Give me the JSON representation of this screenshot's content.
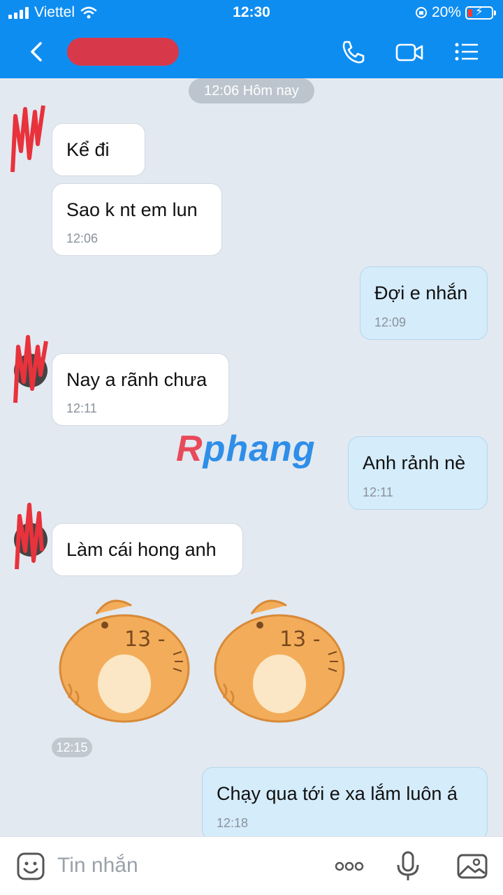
{
  "status": {
    "carrier": "Viettel",
    "time": "12:30",
    "battery": "20%"
  },
  "header": {
    "icons": [
      "back-icon",
      "phone-icon",
      "video-icon",
      "menu-icon"
    ]
  },
  "chat": {
    "date_label": "12:06 Hôm nay",
    "messages": [
      {
        "from": "them",
        "text": "Kể đi",
        "time": ""
      },
      {
        "from": "them",
        "text": "Sao k nt em lun",
        "time": "12:06"
      },
      {
        "from": "me",
        "text": "Đợi e nhắn",
        "time": "12:09"
      },
      {
        "from": "them",
        "text": "Nay a rãnh chưa",
        "time": "12:11"
      },
      {
        "from": "me",
        "text": "Anh rảnh nè",
        "time": "12:11"
      },
      {
        "from": "them",
        "text": "Làm cái hong anh",
        "time": ""
      },
      {
        "from": "me",
        "text": "Chạy qua tới e xa lắm luôn á",
        "time": "12:18"
      }
    ],
    "sticker_time": "12:15",
    "stickers": [
      "cat-sticker",
      "cat-sticker"
    ]
  },
  "watermark": {
    "part1": "R",
    "part2": "phang"
  },
  "input": {
    "placeholder": "Tin nhắn",
    "icons": [
      "emoji-icon",
      "more-icon",
      "mic-icon",
      "image-icon"
    ]
  },
  "colors": {
    "header": "#0e8df1",
    "my_bubble": "#d5ecfb",
    "their_bubble": "#ffffff",
    "background": "#e2e9f1"
  }
}
